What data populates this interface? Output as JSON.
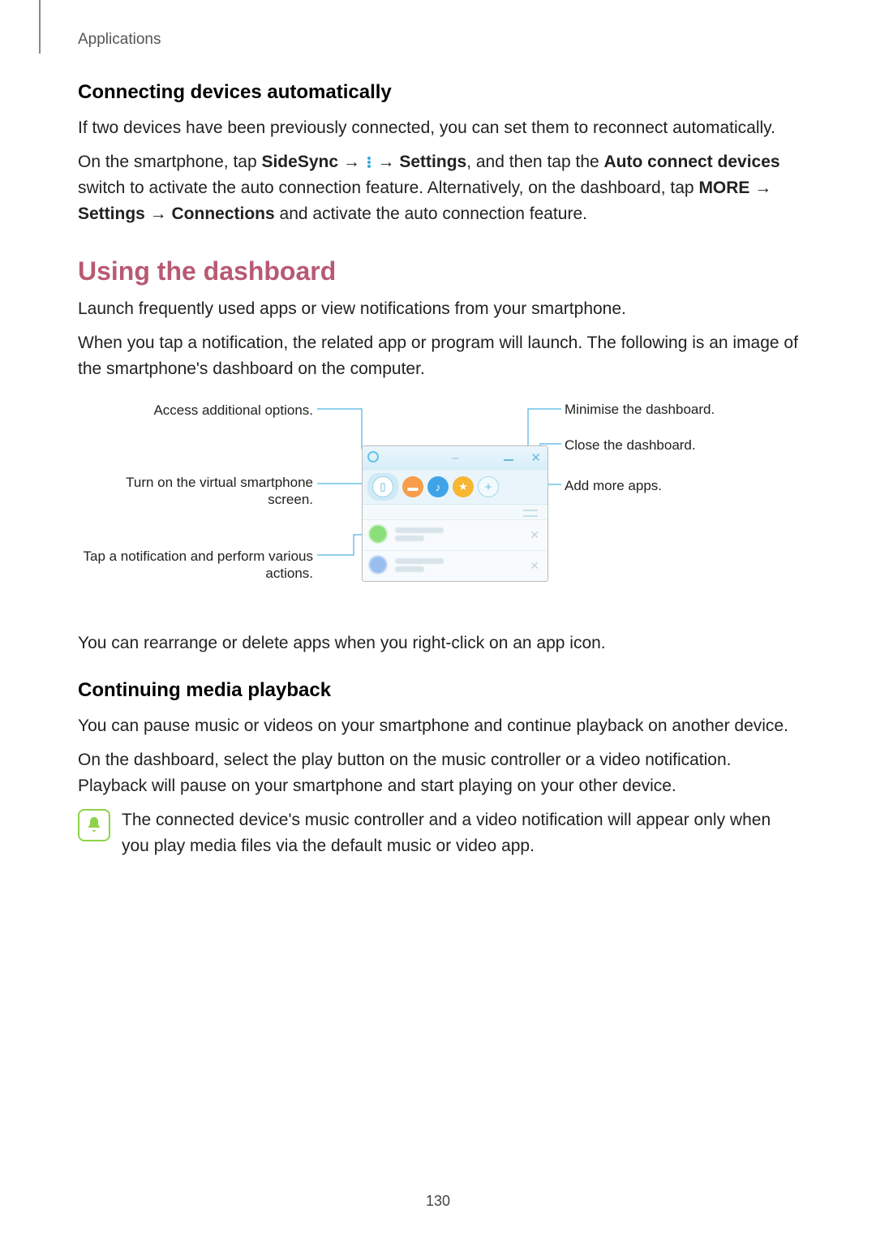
{
  "header": "Applications",
  "h3a": "Connecting devices automatically",
  "p1": "If two devices have been previously connected, you can set them to reconnect automatically.",
  "p2a": "On the smartphone, tap ",
  "p2b": "SideSync",
  "p2c": " → ",
  "p2d": " → ",
  "p2e": "Settings",
  "p2f": ", and then tap the ",
  "p2g": "Auto connect devices",
  "p2h": " switch to activate the auto connection feature. Alternatively, on the dashboard, tap ",
  "p2i": "MORE",
  "p2j": " → ",
  "p2k": "Settings",
  "p2l": " → ",
  "p2m": "Connections",
  "p2n": " and activate the auto connection feature.",
  "h2a": "Using the dashboard",
  "p3": "Launch frequently used apps or view notifications from your smartphone.",
  "p4": "When you tap a notification, the related app or program will launch. The following is an image of the smartphone's dashboard on the computer.",
  "ll1": "Access additional options.",
  "ll2": "Turn on the virtual smartphone screen.",
  "ll3": "Tap a notification and perform various actions.",
  "rl1": "Minimise the dashboard.",
  "rl2": "Close the dashboard.",
  "rl3": "Add more apps.",
  "p5": "You can rearrange or delete apps when you right-click on an app icon.",
  "h3b": "Continuing media playback",
  "p6": "You can pause music or videos on your smartphone and continue playback on another device.",
  "p7": "On the dashboard, select the play button on the music controller or a video notification. Playback will pause on your smartphone and start playing on your other device.",
  "p8": "The connected device's music controller and a video notification will appear only when you play media files via the default music or video app.",
  "pageNum": "130"
}
